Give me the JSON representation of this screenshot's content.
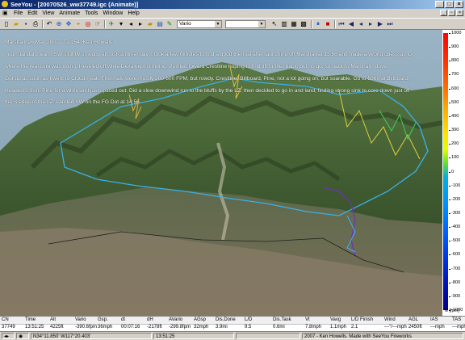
{
  "window": {
    "title": "SeeYou - [20070526_ww37749.igc (Animate)]"
  },
  "menu": [
    "File",
    "Edit",
    "View",
    "Animate",
    "Tools",
    "Window",
    "Help"
  ],
  "toolbar": {
    "combo_value": "Vario"
  },
  "description": {
    "lines": [
      "Marshall, 26 May 2007 - T2 154, Ken Howells",
      "Your standard warm SW slightly smoggy almost-summer day.  I took a few minutes to find a good thermal after launching off Marshall at 13:56 and made a wrong guess as to",
      "where the real core was going.  I leveled off while Dexa kept climbing.  Pointed toward Crestline hoping to find lift further back, but no go, so back to Marshall I dove.",
      "Got up as soon as I went to Cloud Peak.  Thermals were mostly 300-600 FPM, but rowdy.  Crestline, Billboard, Pine, not a lot going on, but soarable.  Go to 5900 at Billboard.",
      "Headed S from Pine for a while and just spaced out.  Did a slow downwind run to the bluffs by the LZ, then decided to go in and land, finding strong sink to core down just off",
      "the S edge of the LZ.  Landed SW on the FG Dot at 14:56."
    ]
  },
  "scale": {
    "labels": [
      "1000",
      "900",
      "800",
      "700",
      "600",
      "500",
      "400",
      "300",
      "200",
      "100",
      "0",
      "-100",
      "-200",
      "-300",
      "-400",
      "-500",
      "-600",
      "-700",
      "-800",
      "-900",
      "-1000"
    ],
    "unit": "w [fpm]"
  },
  "grid": {
    "headers": [
      "CN",
      "Time",
      "Alt",
      "Vario",
      "Gsp.",
      "dt",
      "dH",
      "AVario",
      "AGsp",
      "Dis.Done",
      "L/D",
      "Dis.Task",
      "Vt",
      "Vavg",
      "L/D Finish",
      "Wind",
      "AGL",
      "IAS",
      "TAS"
    ],
    "values": [
      "37749",
      "13:51:25",
      "4225ft",
      "-390.6fpm",
      "36mph",
      "00:07:16",
      "-2178ft",
      "-299.8fpm",
      "32mph",
      "3.9mi",
      "9.5",
      "0.6mi",
      "7.8mph",
      "1.1mph",
      "2.1",
      "---°/---mph",
      "2450ft",
      "---mph",
      "---mph"
    ]
  },
  "status": {
    "coords": "N34°11.850'  W117°20.403'",
    "time": "13:51:25",
    "copyright": "2007 - Ken Howells. Made with SeeYou Fireworks"
  },
  "colors": {
    "sky": "#8fb1c6",
    "terrain_dark": "#2d3a22",
    "terrain_mid": "#4c6a3a",
    "track": "#3ab0e8"
  }
}
